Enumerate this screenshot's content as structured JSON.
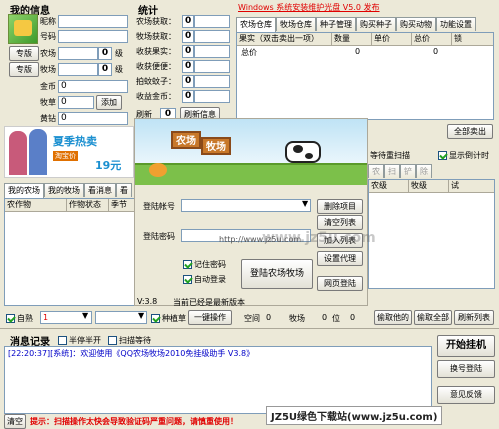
{
  "my_info": {
    "title": "我的信息",
    "nickname_label": "昵称",
    "account_label": "号码",
    "pro1_label": "专版",
    "pro2_label": "专版",
    "farm_label": "农场",
    "farm_value": "0",
    "farm_level": "0",
    "farm_level_unit": "级",
    "ranch_label": "牧场",
    "ranch_value": "0",
    "ranch_level": "0",
    "ranch_level_unit": "级",
    "gold_label": "金币",
    "gold_value": "0",
    "ranch_coin_label": "牧草",
    "ranch_coin_value": "0",
    "add_label": "添加",
    "yellow_label": "黄钻",
    "yellow_value": "0"
  },
  "stats": {
    "title": "统计",
    "rows": [
      {
        "label": "农场获取：",
        "value": "0"
      },
      {
        "label": "牧场获取：",
        "value": "0"
      },
      {
        "label": "收获果实：",
        "value": "0"
      },
      {
        "label": "收获便便：",
        "value": "0"
      },
      {
        "label": "拍蚊蚊子：",
        "value": "0"
      },
      {
        "label": "收益金币：",
        "value": "0"
      }
    ],
    "refresh_label": "刷新",
    "refresh_value": "0",
    "refresh_info_label": "刷新信息"
  },
  "banner_link": "Windows 系统安装维护光盘 V5.0 发布",
  "warehouse": {
    "tabs": [
      "农场仓库",
      "牧场仓库",
      "种子管理",
      "购买种子",
      "购买动物",
      "功能设置"
    ],
    "columns": [
      "果实（双击卖出一项）",
      "数量",
      "单价",
      "总价",
      "锁"
    ],
    "rows": [
      {
        "name": "总价",
        "qty": "0",
        "price": "",
        "total": "0",
        "lock": ""
      }
    ],
    "sell_all_label": "全部卖出"
  },
  "ad": {
    "summer": "夏季热卖",
    "taobao": "淘宝价",
    "price": "19元"
  },
  "friends": {
    "tabs": [
      "我的农场",
      "我的牧场",
      "看消息",
      "看"
    ],
    "columns": [
      "农作物",
      "作物状态",
      "季节"
    ],
    "scan_label": "等待重扫描",
    "countdown_label": "显示倒计时",
    "side_tabs": [
      "农",
      "扫",
      "铲",
      "除"
    ],
    "side_cols": [
      "农级",
      "牧级",
      "试"
    ],
    "space_label": "空间",
    "space_value": "0",
    "ranch_label": "牧场",
    "ranch_value": "0",
    "pos_label": "位",
    "pos_value": "0",
    "get_his_label": "偷取他的",
    "get_all_label": "偷取全部",
    "refresh_list_label": "刷新列表"
  },
  "bottom_controls": {
    "auto_label": "自熟",
    "auto_value": "1",
    "shepherd_label": "种植草",
    "one_click_label": "一键操作"
  },
  "login": {
    "banner_farm": "农场",
    "banner_ranch": "牧场",
    "account_label": "登陆帐号",
    "password_label": "登陆密码",
    "watermark": "http://www.jz5u.com",
    "remember_label": "记住密码",
    "auto_login_label": "自动登录",
    "login_button": "登陆农场牧场",
    "delete_label": "删除项目",
    "clear_label": "清空列表",
    "add_list_label": "加入列表",
    "proxy_label": "设置代理",
    "web_login_label": "网页登陆",
    "version": "V:3.8",
    "latest": "当前已经是最新版本"
  },
  "messages": {
    "title": "消息记录",
    "pause_label": "半停半开",
    "scan_wait_label": "扫描等待",
    "log": "[22:20:37][系统]：欢迎使用《QQ农场牧场2010免挂级助手 V3.8》",
    "clear_label": "清空",
    "tip": "提示：扫描操作太快会导致验证码严重问题，请慎重使用！"
  },
  "right_buttons": {
    "start_label": "开始挂机",
    "switch_label": "换号登陆",
    "feedback_label": "意见反馈"
  },
  "watermark_footer": "JZ5U绿色下载站(www.jz5u.com)",
  "watermark_center": "www.jz5u.com"
}
